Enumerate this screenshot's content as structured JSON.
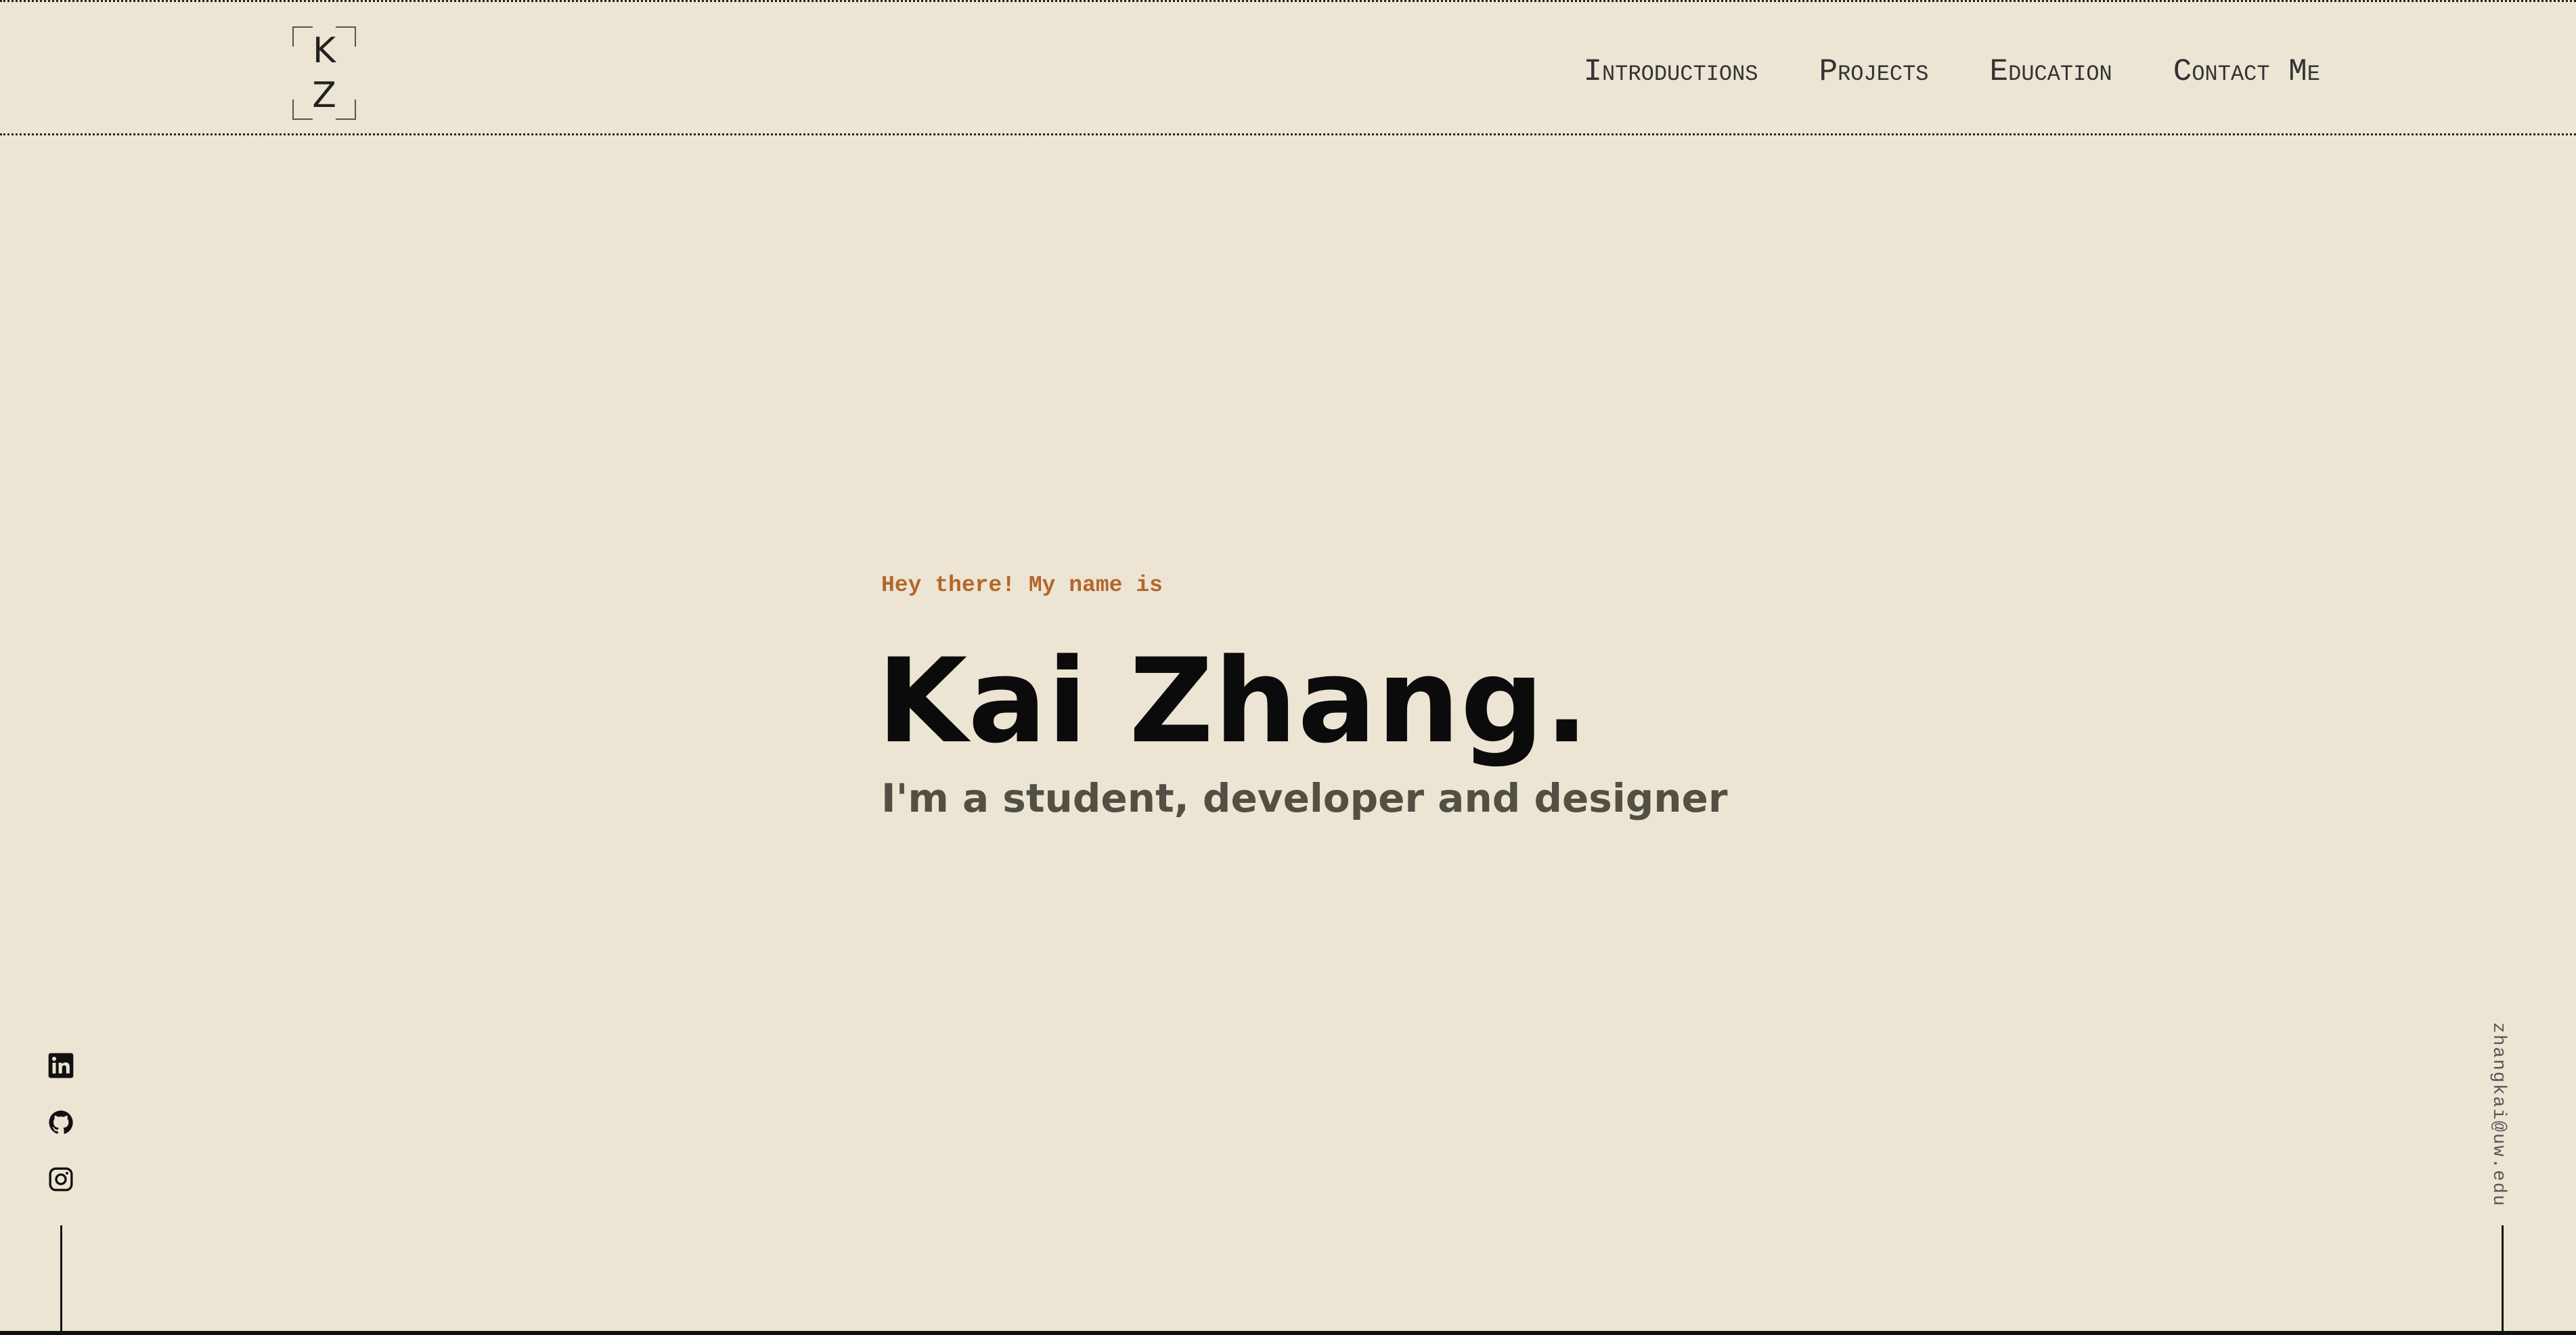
{
  "logo": {
    "line1": "K",
    "line2": "Z"
  },
  "nav": {
    "items": [
      {
        "label": "Introductions"
      },
      {
        "label": "Projects"
      },
      {
        "label": "Education"
      },
      {
        "label": "Contact Me"
      }
    ]
  },
  "hero": {
    "greeting": "Hey there! My name is",
    "name": "Kai Zhang.",
    "tagline": "I'm a student, developer and designer"
  },
  "social": {
    "icons": [
      "linkedin-icon",
      "github-icon",
      "instagram-icon"
    ]
  },
  "contact": {
    "email": "zhangkai@uw.edu"
  },
  "colors": {
    "background": "#ede5d4",
    "accent": "#b3672c",
    "text": "#0b0b0b",
    "subtext": "#525045"
  }
}
